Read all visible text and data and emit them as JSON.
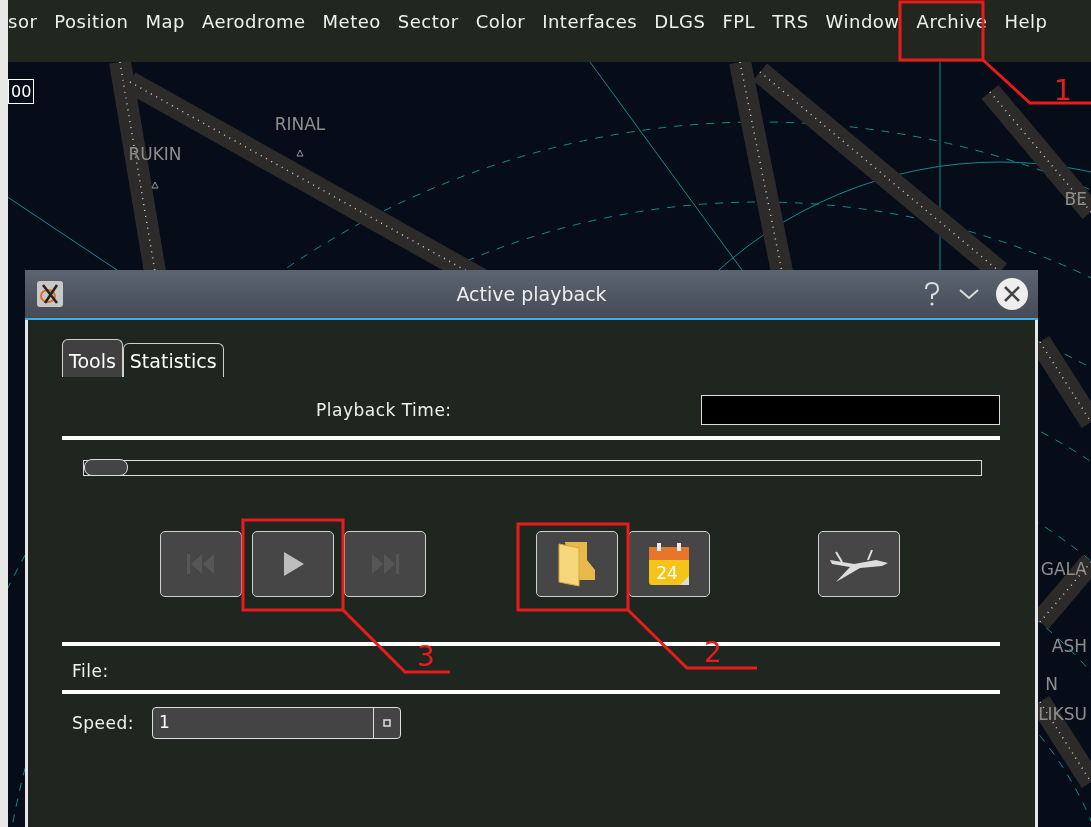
{
  "menu_bar": {
    "items": [
      "sor",
      "Position",
      "Map",
      "Aerodrome",
      "Meteo",
      "Sector",
      "Color",
      "Interfaces",
      "DLGS",
      "FPL",
      "TRS",
      "Window",
      "Archive",
      "Help"
    ]
  },
  "map": {
    "scale_label": "00",
    "waypoints": [
      "RUKIN",
      "RINAL",
      "BE",
      "GALA",
      "ASH",
      "N",
      "LIKSU"
    ]
  },
  "dialog": {
    "title": "Active playback",
    "tabs": [
      {
        "label": "Tools",
        "selected": true
      },
      {
        "label": "Statistics",
        "selected": false
      }
    ],
    "playback_time_label": "Playback Time:",
    "timeline": {
      "level": 0
    },
    "controls": [
      {
        "kind": "rewind",
        "disabled": true
      },
      {
        "kind": "play",
        "disabled": false
      },
      {
        "kind": "forward",
        "disabled": true
      },
      {
        "kind": "folder",
        "disabled": false
      },
      {
        "kind": "calendar",
        "disabled": false,
        "day": "24"
      },
      {
        "kind": "aircraft",
        "disabled": false
      }
    ],
    "file_label": "File:",
    "speed_label": "Speed:",
    "speed_value": "1"
  },
  "annotations": [
    "1",
    "2",
    "3"
  ]
}
